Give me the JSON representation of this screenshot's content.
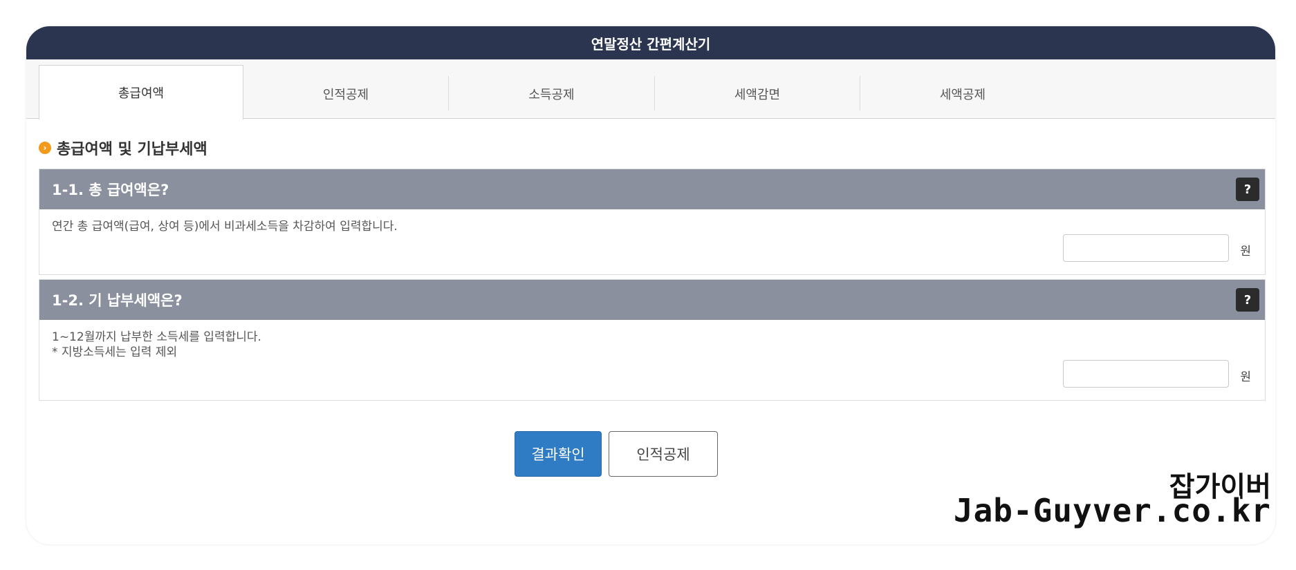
{
  "app": {
    "title": "연말정산 간편계산기"
  },
  "tabs": [
    {
      "label": "총급여액"
    },
    {
      "label": "인적공제"
    },
    {
      "label": "소득공제"
    },
    {
      "label": "세액감면"
    },
    {
      "label": "세액공제"
    }
  ],
  "section": {
    "heading": "총급여액 및 기납부세액"
  },
  "questions": [
    {
      "title": "1-1. 총 급여액은?",
      "description": "연간 총 급여액(급여, 상여 등)에서 비과세소득을 차감하여 입력합니다.",
      "value": "",
      "unit": "원",
      "help": "?"
    },
    {
      "title": "1-2. 기 납부세액은?",
      "description_line1": "1~12월까지 납부한 소득세를 입력합니다.",
      "description_line2": "* 지방소득세는 입력 제외",
      "value": "",
      "unit": "원",
      "help": "?"
    }
  ],
  "buttons": {
    "result": "결과확인",
    "next": "인적공제"
  },
  "watermark": {
    "korean": "잡가이버",
    "english": "Jab-Guyver.co.kr"
  },
  "colors": {
    "titlebar": "#2c3550",
    "question_header": "#8a909d",
    "primary_button": "#2f7bc4",
    "bullet": "#f29a1c"
  }
}
